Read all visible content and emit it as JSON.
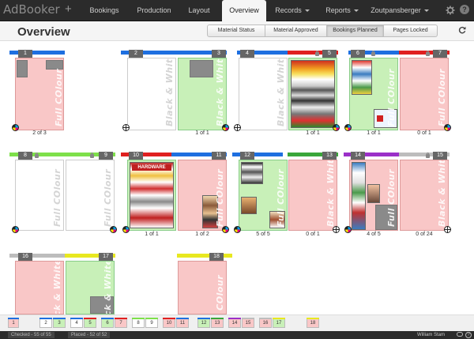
{
  "nav": {
    "brand": "AdBooker",
    "plus": "+",
    "items": [
      {
        "label": "Bookings",
        "dropdown": false,
        "active": false
      },
      {
        "label": "Production",
        "dropdown": false,
        "active": false
      },
      {
        "label": "Layout",
        "dropdown": false,
        "active": false
      },
      {
        "label": "Overview",
        "dropdown": false,
        "active": true
      },
      {
        "label": "Records",
        "dropdown": true,
        "active": false
      },
      {
        "label": "Reports",
        "dropdown": true,
        "active": false
      },
      {
        "label": "Zoutpansberger",
        "dropdown": true,
        "active": false
      }
    ],
    "help": "?"
  },
  "header": {
    "title": "Overview",
    "view_buttons": [
      {
        "label": "Material Status",
        "active": false
      },
      {
        "label": "Material Approved",
        "active": false
      },
      {
        "label": "Bookings Planned",
        "active": true
      },
      {
        "label": "Pages Locked",
        "active": false
      }
    ]
  },
  "colors": {
    "full_colour": "#f9c7c7",
    "black_white": "#ffffff",
    "planned": "#c8f0b8",
    "section_blue": "#1e6fe0",
    "section_red": "#e02020",
    "section_green": "#3aa63a",
    "section_purple": "#9b30c8",
    "section_grey": "#bdbdbd",
    "section_yellow": "#e8e820",
    "section_lime": "#7ee04a"
  },
  "labels": {
    "full_colour": "Full COlour",
    "black_white": "Black & White"
  },
  "pages": [
    {
      "num": "1",
      "type": "full",
      "label": "full_colour",
      "count": "2 of 3"
    },
    {
      "num": "2",
      "type": "bw",
      "label": "black_white",
      "count": ""
    },
    {
      "num": "3",
      "type": "planned",
      "label": "black_white",
      "count": "1 of 1"
    },
    {
      "num": "4",
      "type": "bw",
      "label": "black_white",
      "count": ""
    },
    {
      "num": "5",
      "type": "planned",
      "label": "full_colour",
      "count": "1 of 1"
    },
    {
      "num": "6",
      "type": "planned",
      "label": "full_colour",
      "count": "1 of 1"
    },
    {
      "num": "7",
      "type": "full",
      "label": "full_colour",
      "count": "0 of 1"
    },
    {
      "num": "8",
      "type": "bw",
      "label": "full_colour",
      "count": ""
    },
    {
      "num": "9",
      "type": "bw",
      "label": "full_colour",
      "count": ""
    },
    {
      "num": "10",
      "type": "planned",
      "label": "full_colour",
      "count": "1 of 1"
    },
    {
      "num": "11",
      "type": "full",
      "label": "full_colour",
      "count": "1 of 2"
    },
    {
      "num": "12",
      "type": "planned",
      "label": "full_colour",
      "count": "5 of 5"
    },
    {
      "num": "13",
      "type": "full",
      "label": "black_white",
      "count": "0 of 1"
    },
    {
      "num": "14",
      "type": "full",
      "label": "full_colour",
      "count": "4 of 5"
    },
    {
      "num": "15",
      "type": "full",
      "label": "black_white",
      "count": "0 of 24"
    },
    {
      "num": "16",
      "type": "full",
      "label": "black_white",
      "count": ""
    },
    {
      "num": "17",
      "type": "planned",
      "label": "black_white",
      "count": ""
    },
    {
      "num": "18",
      "type": "full",
      "label": "full_colour",
      "count": ""
    }
  ],
  "thumbs": [
    {
      "num": "1",
      "type": "full"
    },
    {
      "num": "2",
      "type": "bw"
    },
    {
      "num": "3",
      "type": "planned"
    },
    {
      "num": "4",
      "type": "bw"
    },
    {
      "num": "5",
      "type": "planned"
    },
    {
      "num": "6",
      "type": "planned"
    },
    {
      "num": "7",
      "type": "full"
    },
    {
      "num": "8",
      "type": "bw"
    },
    {
      "num": "9",
      "type": "bw"
    },
    {
      "num": "10",
      "type": "full"
    },
    {
      "num": "11",
      "type": "full"
    },
    {
      "num": "12",
      "type": "planned"
    },
    {
      "num": "13",
      "type": "full"
    },
    {
      "num": "14",
      "type": "full"
    },
    {
      "num": "15",
      "type": "full"
    },
    {
      "num": "16",
      "type": "full"
    },
    {
      "num": "17",
      "type": "planned"
    },
    {
      "num": "18",
      "type": "full"
    }
  ],
  "status": {
    "checked": "Checked - 55 of 55",
    "placed": "Placed - 52 of 52",
    "user": "William Stam",
    "help": "?"
  },
  "ads": {
    "hardware_title": "HARDWARE"
  }
}
